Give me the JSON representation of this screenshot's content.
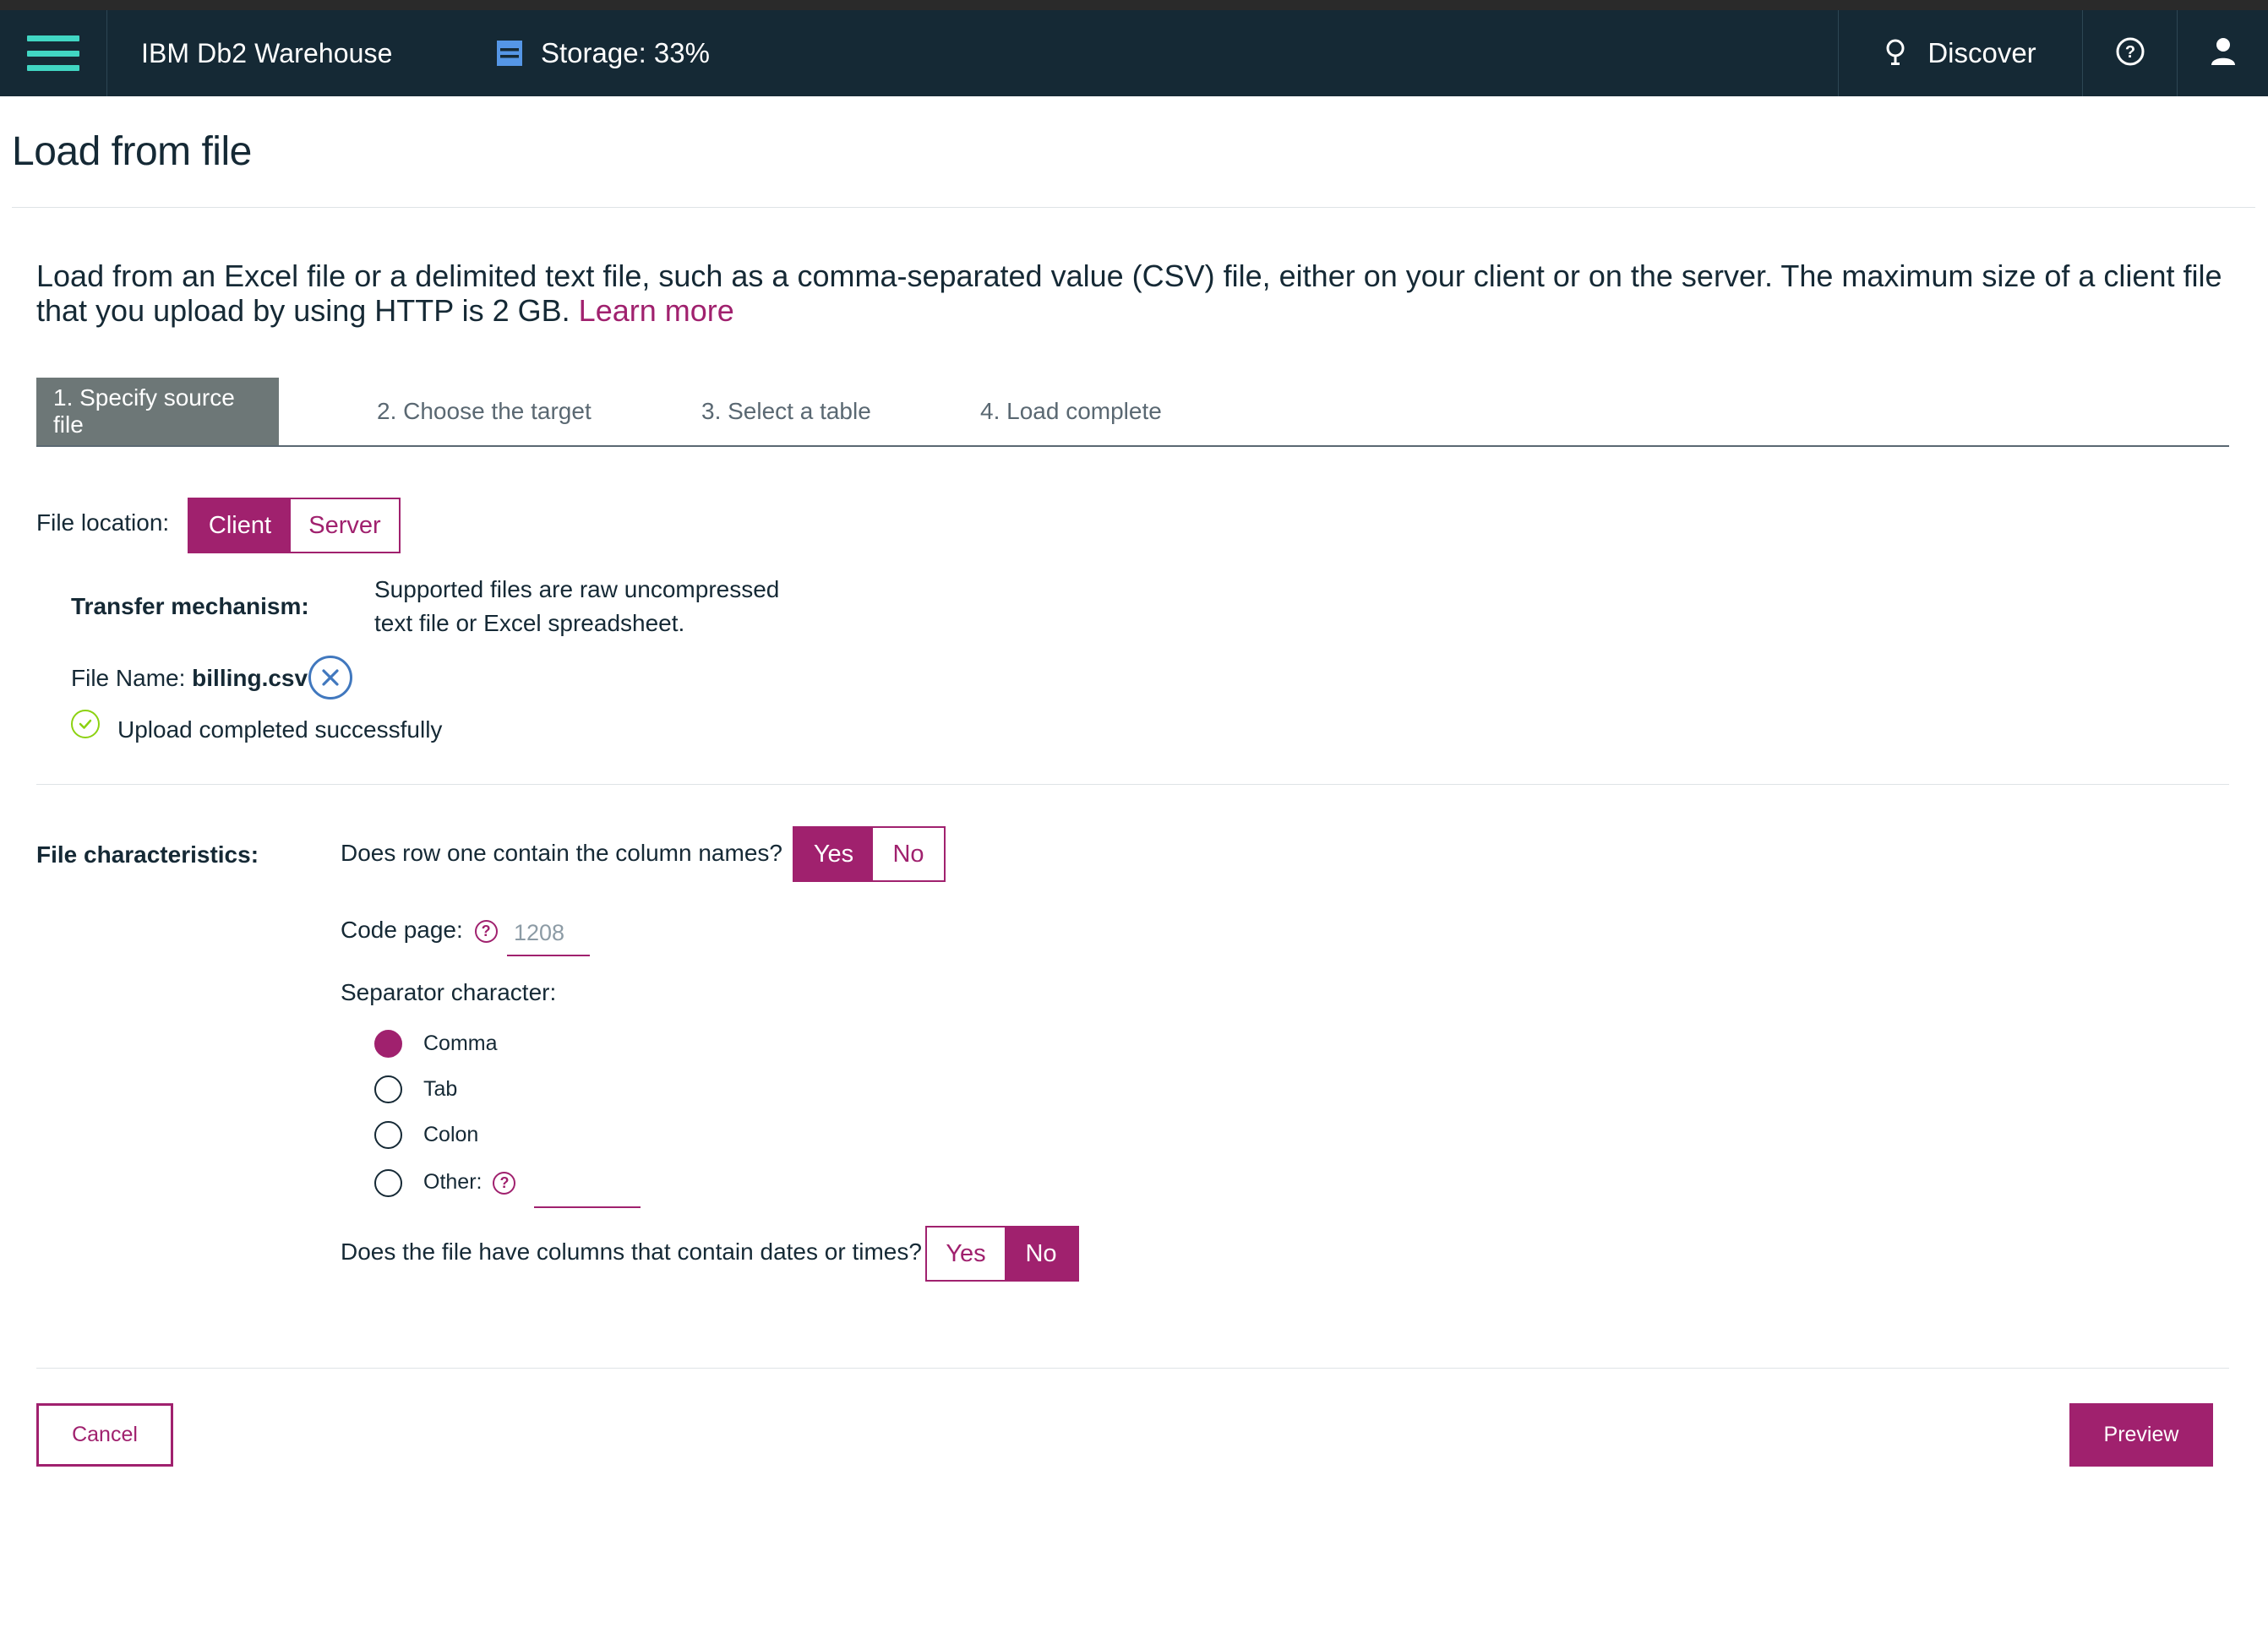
{
  "header": {
    "app_name": "IBM Db2 Warehouse",
    "storage_label": "Storage: 33%",
    "storage_percent": 33,
    "discover_label": "Discover",
    "icons": {
      "menu": "hamburger-menu-icon",
      "storage": "database-icon",
      "discover": "lightbulb-icon",
      "help": "help-icon",
      "user": "user-icon"
    }
  },
  "page": {
    "title": "Load from file",
    "intro": "Load from an Excel file or a delimited text file, such as a comma-separated value (CSV) file, either on your client or on the server. The maximum size of a client file that you upload by using HTTP is 2 GB.",
    "learn_more": "Learn more"
  },
  "steps": [
    {
      "label": "1. Specify source file",
      "active": true
    },
    {
      "label": "2. Choose the target",
      "active": false
    },
    {
      "label": "3. Select a table",
      "active": false
    },
    {
      "label": "4. Load complete",
      "active": false
    }
  ],
  "file_location": {
    "label": "File location:",
    "options": [
      "Client",
      "Server"
    ],
    "selected": "Client"
  },
  "transfer": {
    "label": "Transfer mechanism:",
    "note_line1": "Supported files are raw uncompressed",
    "note_line2": "text file or Excel spreadsheet."
  },
  "upload": {
    "file_name_label": "File Name:",
    "file_name": "billing.csv",
    "status": "Upload completed successfully"
  },
  "characteristics": {
    "label": "File characteristics:",
    "header_question": "Does row one contain the column names?",
    "header_options": [
      "Yes",
      "No"
    ],
    "header_selected": "Yes",
    "code_page_label": "Code page:",
    "code_page_value": "1208",
    "separator_label": "Separator character:",
    "separators": [
      "Comma",
      "Tab",
      "Colon",
      "Other:"
    ],
    "separator_selected": "Comma",
    "dates_question": "Does the file have columns that contain dates or times?",
    "dates_options": [
      "Yes",
      "No"
    ],
    "dates_selected": "No"
  },
  "footer": {
    "cancel": "Cancel",
    "preview": "Preview"
  },
  "colors": {
    "accent": "#a0216e",
    "header_bg": "#152935",
    "menu_icon": "#41d6c3",
    "success": "#8cd211",
    "info_blue": "#4178be"
  }
}
